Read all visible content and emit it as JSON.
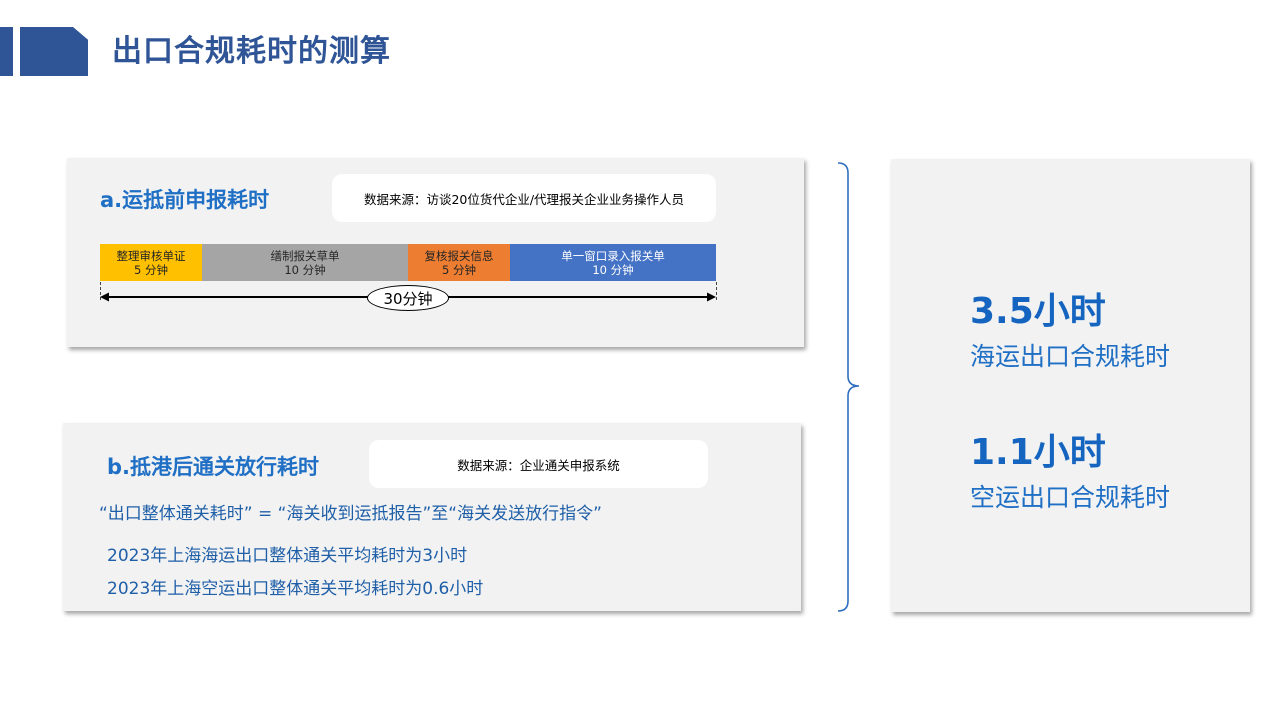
{
  "header": {
    "title": "出口合规耗时的测算"
  },
  "section_a": {
    "title": "a.运抵前申报耗时",
    "source": "数据来源：访谈20位货代企业/代理报关企业业务操作人员",
    "steps": [
      {
        "label": "整理审核单证",
        "duration": "5 分钟",
        "color": "#ffc000"
      },
      {
        "label": "缮制报关草单",
        "duration": "10 分钟",
        "color": "#a5a5a5"
      },
      {
        "label": "复核报关信息",
        "duration": "5 分钟",
        "color": "#ed7d31"
      },
      {
        "label": "单一窗口录入报关单",
        "duration": "10 分钟",
        "color": "#4472c4"
      }
    ],
    "total": "30分钟"
  },
  "section_b": {
    "title": "b.抵港后通关放行耗时",
    "source": "数据来源：企业通关申报系统",
    "definition": "“出口整体通关耗时” = “海关收到运抵报告”至“海关发送放行指令”",
    "stats": [
      "2023年上海海运出口整体通关平均耗时为3小时",
      "2023年上海空运出口整体通关平均耗时为0.6小时"
    ]
  },
  "summary": [
    {
      "value": "3.5小时",
      "label": "海运出口合规耗时"
    },
    {
      "value": "1.1小时",
      "label": "空运出口合规耗时"
    }
  ],
  "colors": {
    "accent": "#2f5597",
    "highlight": "#1565c0",
    "panel": "#f2f2f2"
  }
}
